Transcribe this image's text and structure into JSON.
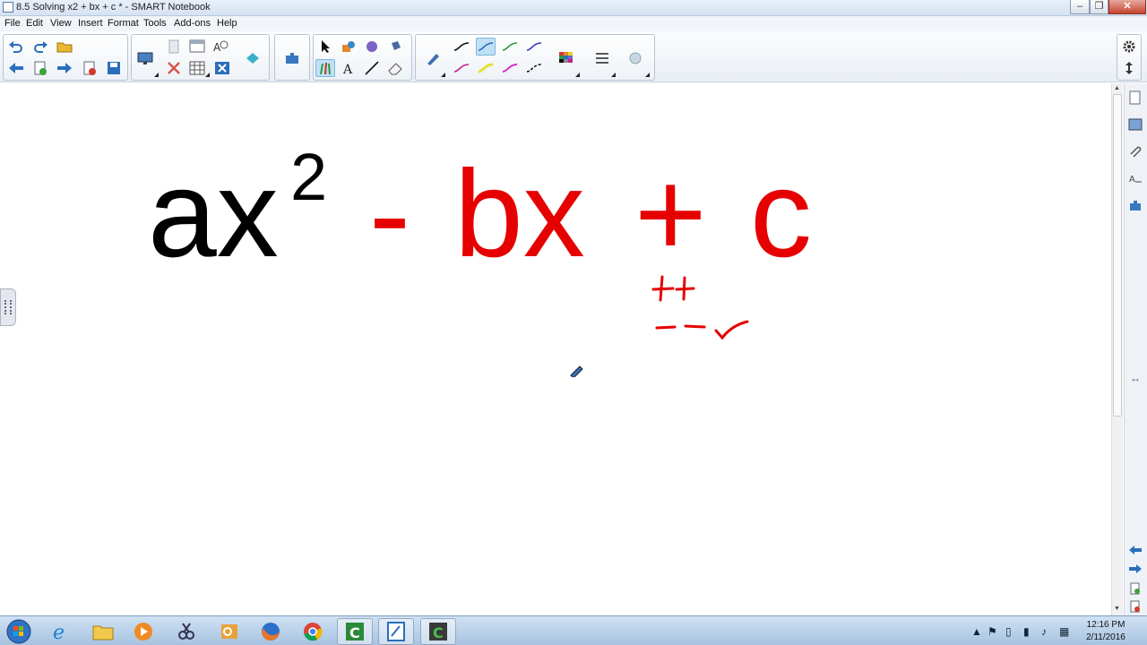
{
  "window": {
    "title": "8.5 Solving x2 + bx + c * - SMART Notebook",
    "min_glyph": "‒",
    "max_glyph": "❐",
    "close_glyph": "✕"
  },
  "menu": {
    "items": [
      "File",
      "Edit",
      "View",
      "Insert",
      "Format",
      "Tools",
      "Add-ons",
      "Help"
    ]
  },
  "canvas": {
    "expression": {
      "part_ax": "ax",
      "exponent": "2",
      "minus": "-",
      "bx": "bx",
      "plus": "+",
      "c": "c"
    },
    "annotation_plus": "++",
    "annotation_minus": "− −",
    "annotation_check": "✓"
  },
  "colors": {
    "black_text": "#000000",
    "red_text": "#e60000",
    "accent": "#2a6ebb"
  },
  "taskbar": {
    "apps": [
      "start-orb",
      "internet-explorer",
      "file-explorer",
      "media-player",
      "snipping-tool",
      "outlook",
      "firefox",
      "chrome",
      "camtasia-recorder",
      "smart-notebook",
      "camtasia-studio"
    ],
    "time": "12:16 PM",
    "date": "2/11/2016"
  }
}
